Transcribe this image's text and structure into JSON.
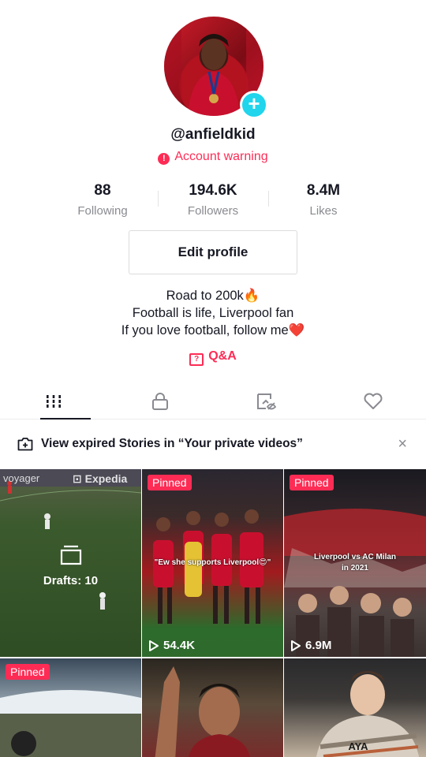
{
  "profile": {
    "username": "@anfieldkid",
    "warning_text": "Account warning",
    "avatar_icon": "avatar-photo",
    "add_icon": "plus-icon"
  },
  "stats": [
    {
      "value": "88",
      "label": "Following"
    },
    {
      "value": "194.6K",
      "label": "Followers"
    },
    {
      "value": "8.4M",
      "label": "Likes"
    }
  ],
  "edit_profile_label": "Edit profile",
  "bio": {
    "line1": "Road to 200k🔥",
    "line2": "Football is life, Liverpool fan",
    "line3": "If you love football, follow me❤️"
  },
  "qa_label": "Q&A",
  "tabs": [
    {
      "icon": "grid-icon",
      "active": true
    },
    {
      "icon": "lock-icon",
      "active": false
    },
    {
      "icon": "tagged-icon",
      "active": false
    },
    {
      "icon": "heart-icon",
      "active": false
    }
  ],
  "banner": {
    "text": "View expired Stories in “Your private videos”",
    "close": "×"
  },
  "videos": [
    {
      "type": "drafts",
      "label": "Drafts: 10",
      "overlay_left": "voyager",
      "overlay_right": "Expedia"
    },
    {
      "type": "video",
      "pinned": "Pinned",
      "caption": "\"Ew she supports Liverpool😍\"",
      "views": "54.4K"
    },
    {
      "type": "video",
      "pinned": "Pinned",
      "caption_line1": "Liverpool vs AC Milan",
      "caption_line2": "in 2021",
      "views": "6.9M"
    },
    {
      "type": "video",
      "pinned": "Pinned"
    },
    {
      "type": "video"
    },
    {
      "type": "video",
      "shirt_text": "AYA"
    }
  ],
  "colors": {
    "accent": "#fe2c55",
    "plus": "#20d5ec",
    "text": "#161823",
    "secondary": "#8a8b91"
  }
}
